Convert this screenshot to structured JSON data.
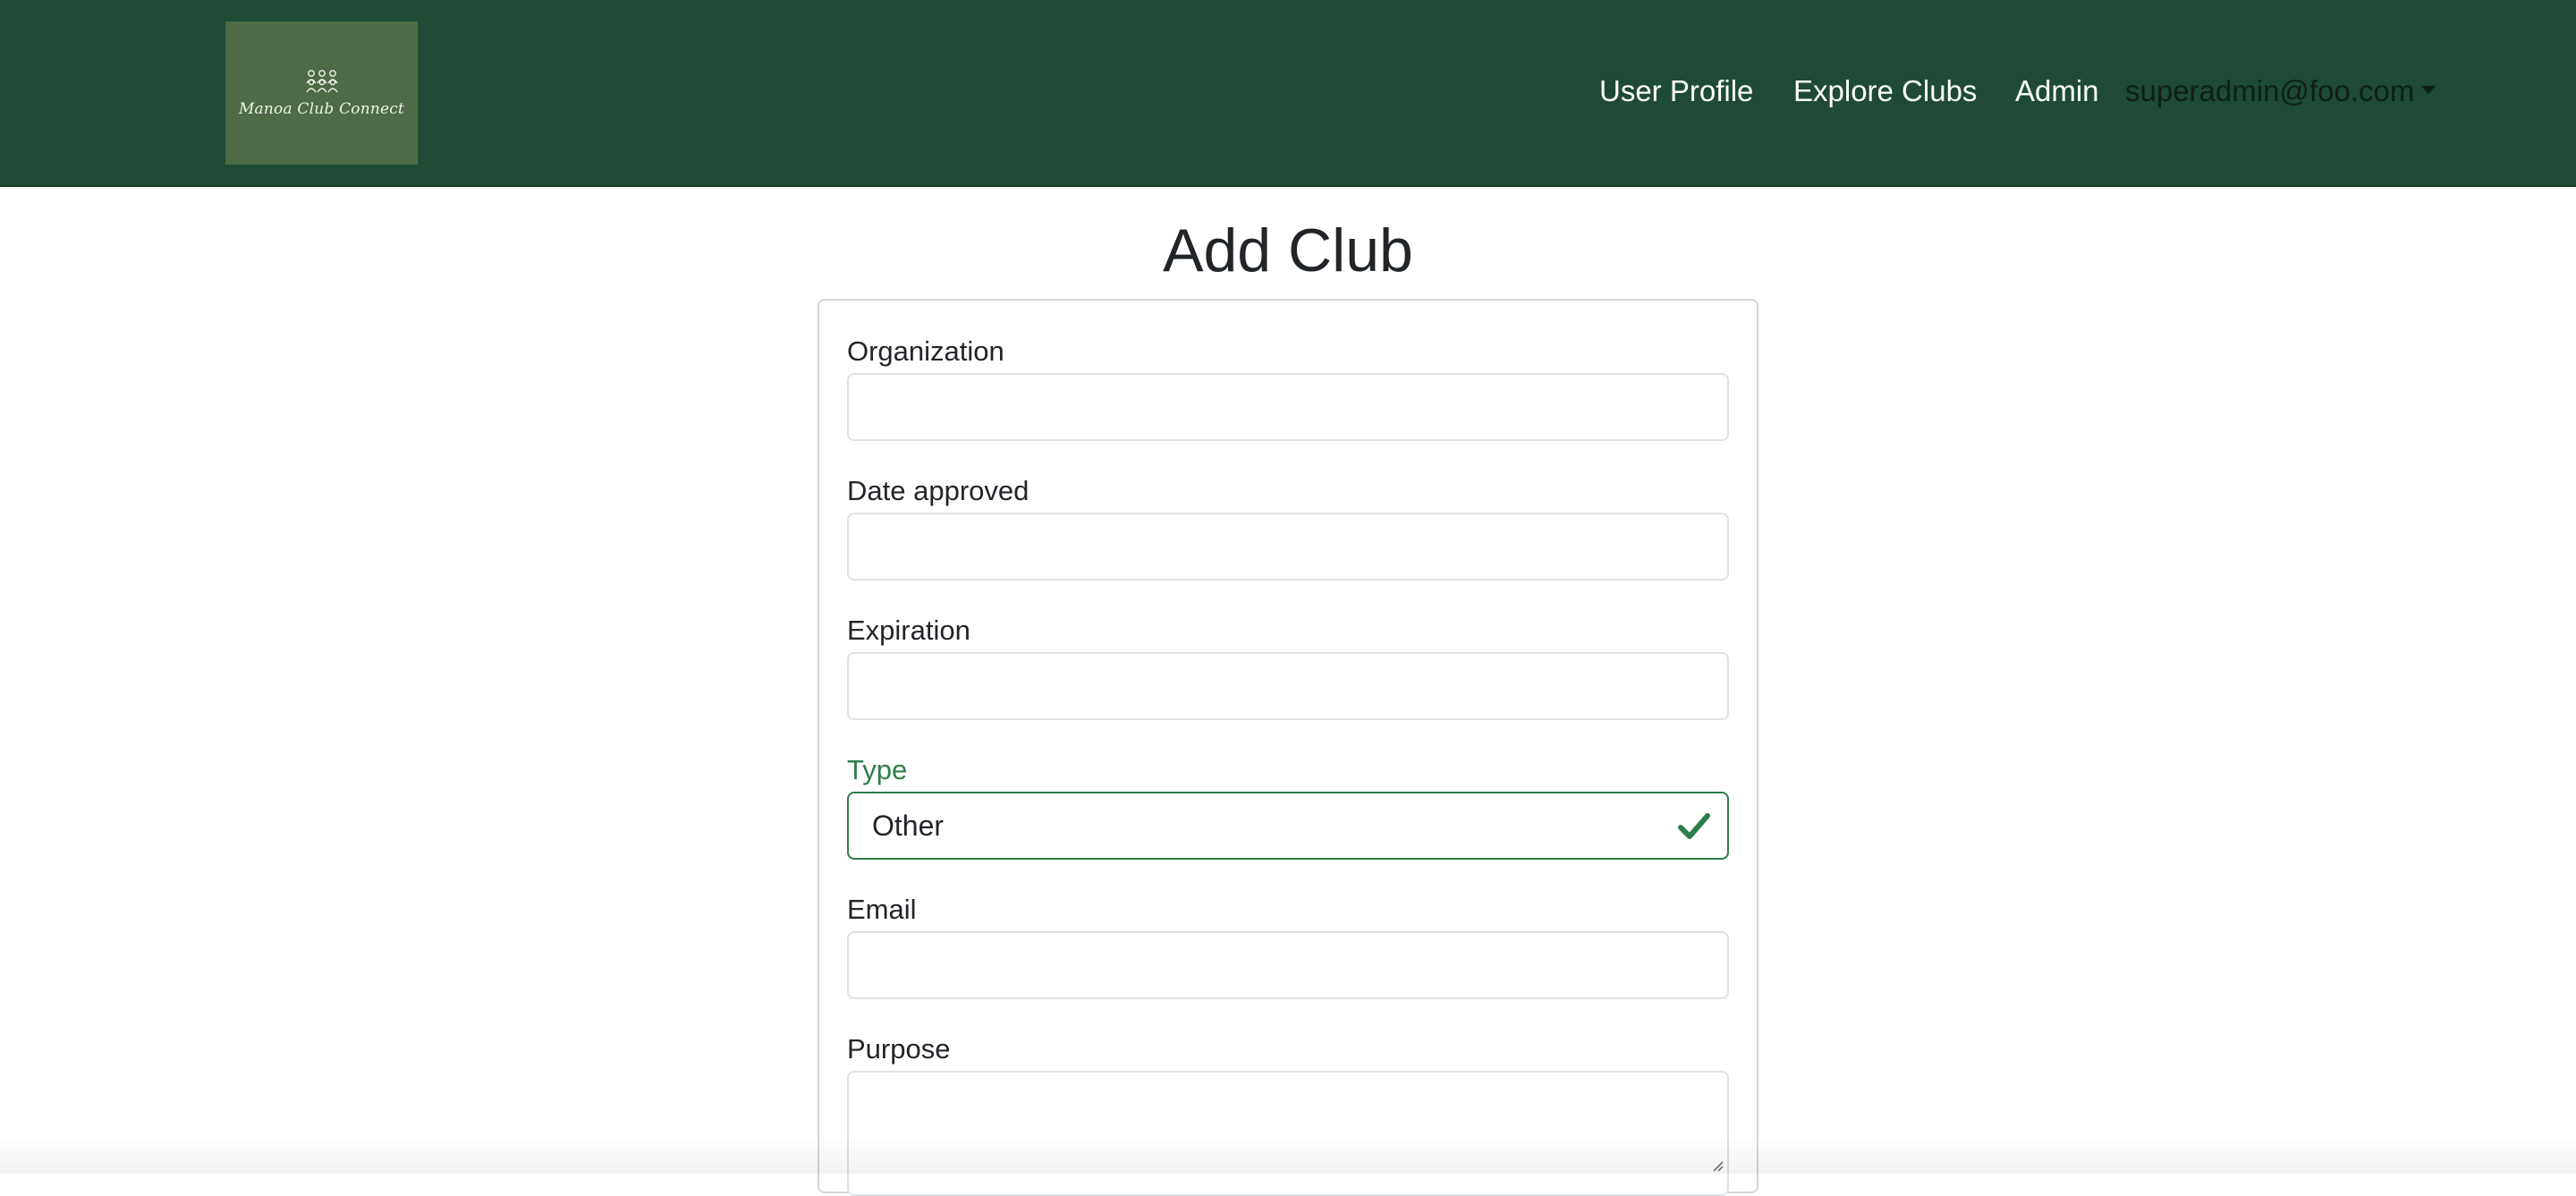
{
  "brand": {
    "logo_text": "Manoa Club Connect",
    "logo_icon": "people-group-icon"
  },
  "nav": {
    "items": [
      {
        "label": "User Profile"
      },
      {
        "label": "Explore Clubs"
      },
      {
        "label": "Admin"
      }
    ],
    "user_email": "superadmin@foo.com"
  },
  "page": {
    "title": "Add Club"
  },
  "form": {
    "organization": {
      "label": "Organization",
      "value": ""
    },
    "date_approved": {
      "label": "Date approved",
      "value": ""
    },
    "expiration": {
      "label": "Expiration",
      "value": ""
    },
    "type": {
      "label": "Type",
      "value": "Other",
      "state": "valid"
    },
    "email": {
      "label": "Email",
      "value": ""
    },
    "purpose": {
      "label": "Purpose",
      "value": ""
    }
  },
  "colors": {
    "navbar": "#1f4a35",
    "logo_bg": "#4e6a46",
    "valid": "#2e7d4a"
  }
}
